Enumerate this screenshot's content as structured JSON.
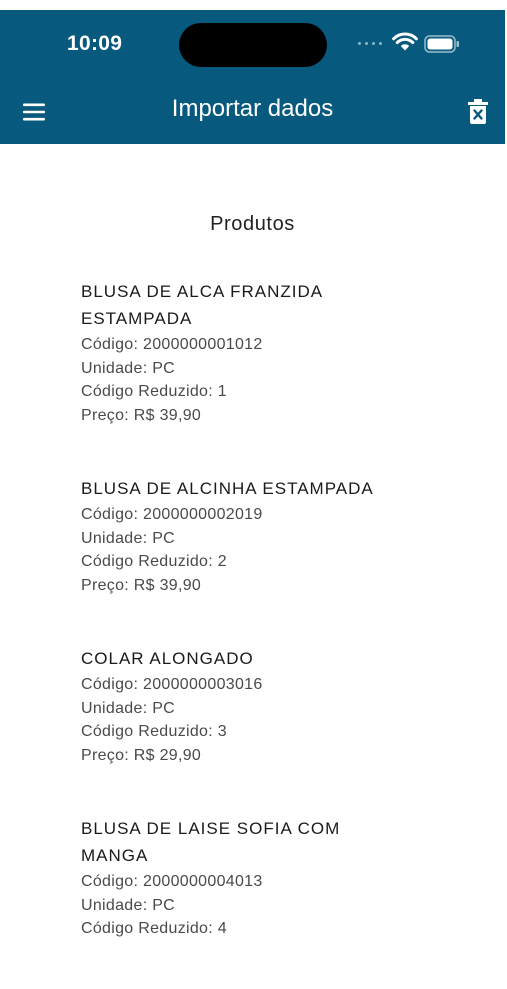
{
  "status_bar": {
    "time": "10:09",
    "icons": [
      "signal-icon",
      "wifi-icon",
      "battery-icon"
    ]
  },
  "app_bar": {
    "title": "Importar dados",
    "menu_icon": "hamburger-menu-icon",
    "action_icon": "delete-icon"
  },
  "colors": {
    "primary": "#075a7e",
    "on_primary": "#ffffff",
    "text_primary": "#1a1a1a",
    "text_secondary": "#4a4a4a"
  },
  "section": {
    "title": "Produtos"
  },
  "products": [
    {
      "name": "BLUSA DE ALCA FRANZIDA ESTAMPADA",
      "codigo": "Código: 2000000001012",
      "unidade": "Unidade: PC",
      "codigo_reduzido": "Código Reduzido: 1",
      "preco": "Preço: R$ 39,90"
    },
    {
      "name": "BLUSA DE ALCINHA ESTAMPADA",
      "codigo": "Código: 2000000002019",
      "unidade": "Unidade: PC",
      "codigo_reduzido": "Código Reduzido: 2",
      "preco": "Preço: R$ 39,90"
    },
    {
      "name": "COLAR ALONGADO",
      "codigo": "Código: 2000000003016",
      "unidade": "Unidade: PC",
      "codigo_reduzido": "Código Reduzido: 3",
      "preco": "Preço: R$ 29,90"
    },
    {
      "name": "BLUSA DE LAISE SOFIA COM MANGA",
      "codigo": "Código: 2000000004013",
      "unidade": "Unidade: PC",
      "codigo_reduzido": "Código Reduzido: 4",
      "preco": ""
    }
  ]
}
